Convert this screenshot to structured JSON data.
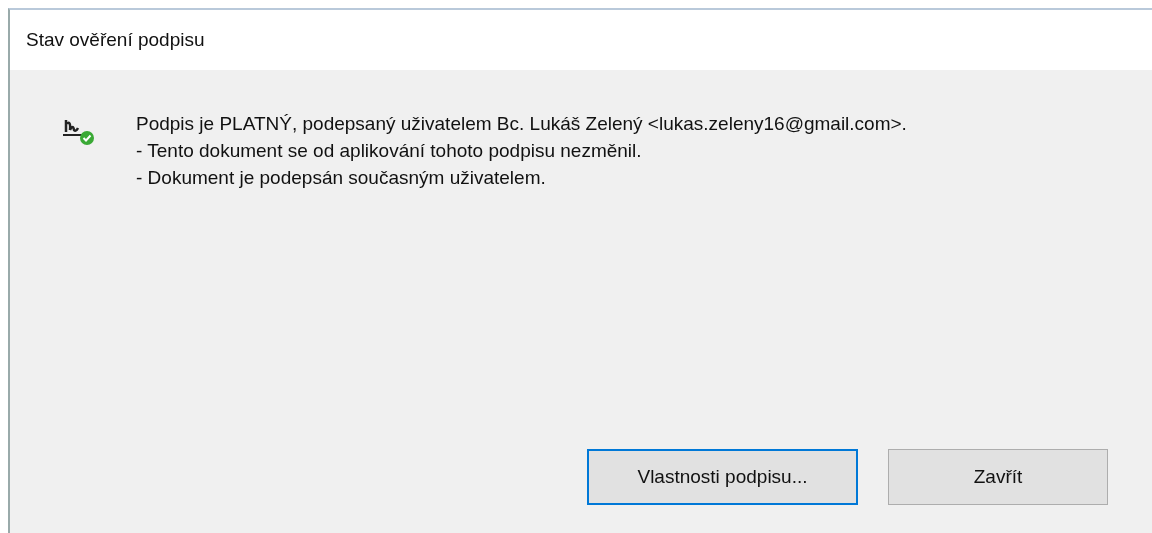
{
  "window": {
    "title": "Stav ověření podpisu"
  },
  "message": {
    "lines": [
      "Podpis je PLATNÝ, podepsaný uživatelem Bc. Lukáš Zelený <lukas.zeleny16@gmail.com>.",
      "- Tento dokument se od aplikování tohoto podpisu nezměnil.",
      "- Dokument je podepsán současným uživatelem."
    ]
  },
  "buttons": [
    {
      "label": "Vlastnosti podpisu...",
      "focused": true
    },
    {
      "label": "Zavřít",
      "focused": false
    }
  ]
}
